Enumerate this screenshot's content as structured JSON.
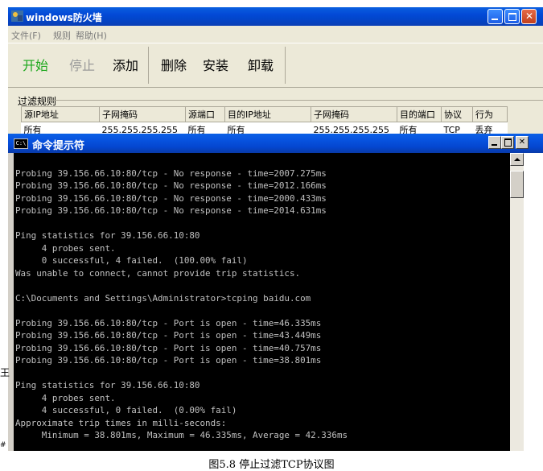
{
  "firewall": {
    "title": "windows防火墙",
    "menu": [
      "文件(F)",
      "规则",
      "帮助(H)"
    ],
    "toolbar": {
      "start": "开始",
      "stop": "停止",
      "add": "添加",
      "delete": "删除",
      "install": "安装",
      "uninstall": "卸载"
    },
    "colors": {
      "start": "#1ba71b",
      "stop": "#9a9a9a"
    },
    "rules_label": "过滤规则",
    "table": {
      "headers": [
        "源IP地址",
        "子网掩码",
        "源端口",
        "目的IP地址",
        "子网掩码",
        "目的端口",
        "协议",
        "行为"
      ],
      "rows": [
        [
          "所有",
          "255.255.255.255",
          "所有",
          "所有",
          "255.255.255.255",
          "所有",
          "TCP",
          "丢弃"
        ]
      ]
    }
  },
  "cmd": {
    "title": "命令提示符",
    "icon_label": "C:\\",
    "lines": [
      "",
      "Probing 39.156.66.10:80/tcp - No response - time=2007.275ms",
      "Probing 39.156.66.10:80/tcp - No response - time=2012.166ms",
      "Probing 39.156.66.10:80/tcp - No response - time=2000.433ms",
      "Probing 39.156.66.10:80/tcp - No response - time=2014.631ms",
      "",
      "Ping statistics for 39.156.66.10:80",
      "     4 probes sent.",
      "     0 successful, 4 failed.  (100.00% fail)",
      "Was unable to connect, cannot provide trip statistics.",
      "",
      "C:\\Documents and Settings\\Administrator>tcping baidu.com",
      "",
      "Probing 39.156.66.10:80/tcp - Port is open - time=46.335ms",
      "Probing 39.156.66.10:80/tcp - Port is open - time=43.449ms",
      "Probing 39.156.66.10:80/tcp - Port is open - time=40.757ms",
      "Probing 39.156.66.10:80/tcp - Port is open - time=38.801ms",
      "",
      "Ping statistics for 39.156.66.10:80",
      "     4 probes sent.",
      "     4 successful, 0 failed.  (0.00% fail)",
      "Approximate trip times in milli-seconds:",
      "     Minimum = 38.801ms, Maximum = 46.335ms, Average = 42.336ms"
    ]
  },
  "edge_marks": [
    "王",
    "#"
  ],
  "caption": "图5.8 停止过滤TCP协议图"
}
